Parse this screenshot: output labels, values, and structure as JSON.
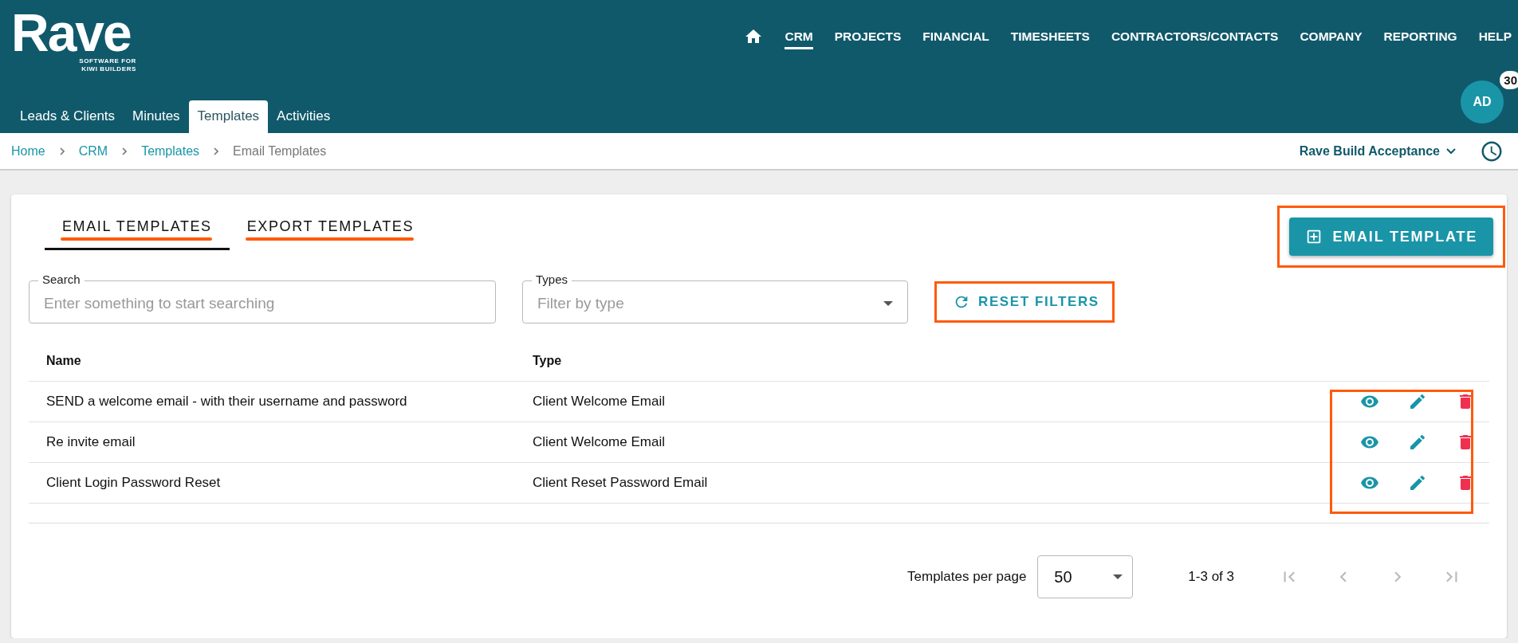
{
  "logo": {
    "name": "Rave",
    "tagline_1": "SOFTWARE FOR",
    "tagline_2": "KIWI BUILDERS"
  },
  "main_nav": [
    {
      "label": "CRM",
      "selected": true
    },
    {
      "label": "PROJECTS",
      "selected": false
    },
    {
      "label": "FINANCIAL",
      "selected": false
    },
    {
      "label": "TIMESHEETS",
      "selected": false
    },
    {
      "label": "CONTRACTORS/CONTACTS",
      "selected": false
    },
    {
      "label": "COMPANY",
      "selected": false
    },
    {
      "label": "REPORTING",
      "selected": false
    },
    {
      "label": "HELP",
      "selected": false
    }
  ],
  "avatar": {
    "initials": "AD",
    "badge": "30"
  },
  "sub_tabs": [
    {
      "label": "Leads & Clients",
      "selected": false
    },
    {
      "label": "Minutes",
      "selected": false
    },
    {
      "label": "Templates",
      "selected": true
    },
    {
      "label": "Activities",
      "selected": false
    }
  ],
  "breadcrumb": [
    "Home",
    "CRM",
    "Templates",
    "Email Templates"
  ],
  "company_selector": "Rave Build Acceptance",
  "page_tabs": [
    {
      "label": "EMAIL TEMPLATES",
      "selected": true,
      "highlighted": true
    },
    {
      "label": "EXPORT TEMPLATES",
      "selected": false,
      "highlighted": true
    }
  ],
  "add_button": {
    "label": "EMAIL TEMPLATE",
    "highlighted": true
  },
  "filters": {
    "search": {
      "label": "Search",
      "placeholder": "Enter something to start searching"
    },
    "types": {
      "label": "Types",
      "placeholder": "Filter by type"
    },
    "reset": {
      "label": "RESET FILTERS",
      "highlighted": true
    }
  },
  "table": {
    "columns": [
      "Name",
      "Type"
    ],
    "actions_highlighted": true,
    "rows": [
      {
        "name": "SEND a welcome email - with their username and password",
        "type": "Client Welcome Email"
      },
      {
        "name": "Re invite email",
        "type": "Client Welcome Email"
      },
      {
        "name": "Client Login Password Reset",
        "type": "Client Reset Password Email"
      }
    ]
  },
  "pagination": {
    "per_page_label": "Templates per page",
    "per_page": "50",
    "range": "1-3 of 3",
    "first_disabled": true,
    "prev_disabled": true,
    "next_disabled": true,
    "last_disabled": true
  }
}
